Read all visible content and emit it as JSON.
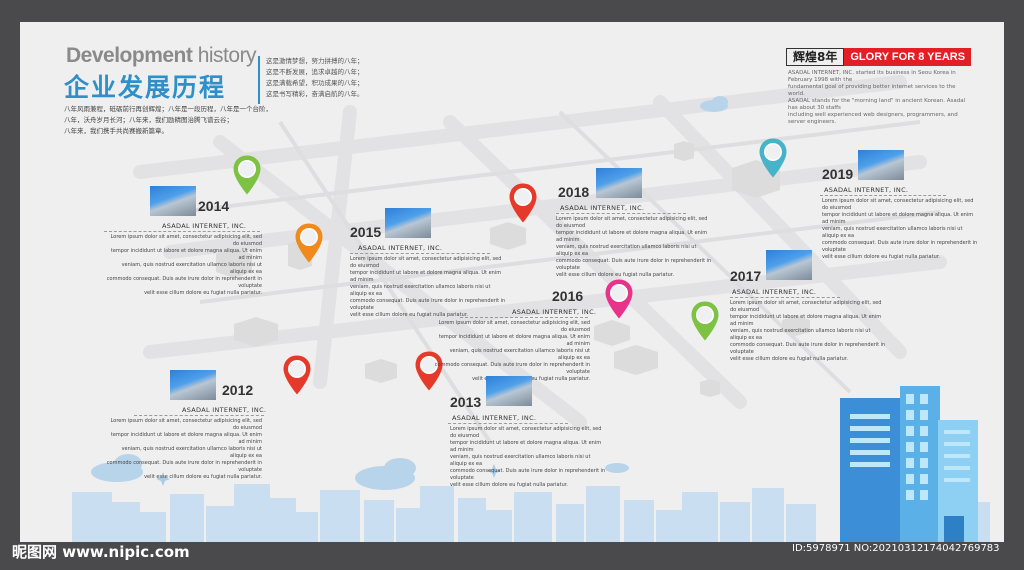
{
  "header": {
    "title_en_bold": "Development",
    "title_en_light": " history",
    "title_cn": "企业发展历程",
    "intro_lines": [
      "八年风雨兼程，砥砺前行再创辉煌；八年是一段历程，八年是一个台阶，",
      "八年，沃舟岁月长河；八年来，我们励精图治腾飞谱云谷；",
      "八年来，我们携手共尚赛搬新篇章。"
    ],
    "poem_lines": [
      "这是激情梦想，努力拼搏的八年；",
      "这是不断发展，追求卓越的八年；",
      "这是满载希望，积功成果的八年；",
      "这是书写精彩，奋满启航的八年。"
    ]
  },
  "badge": {
    "cn": "辉煌8年",
    "en": "GLORY FOR 8 YEARS",
    "text_lines": [
      "ASADAL INTERNET, INC. started its business in Seou Korea in February 1998 with the",
      "fundamental goal of providing better internet services to the world.",
      "ASADAL stands for the \"morning land\" in ancient Korean. Asadal has about 30 staffs",
      "including well experienced web designers, programmers, and server engineers."
    ]
  },
  "milestones": [
    {
      "year": "2014",
      "company": "ASADAL INTERNET, INC."
    },
    {
      "year": "2015",
      "company": "ASADAL INTERNET, INC."
    },
    {
      "year": "2018",
      "company": "ASADAL INTERNET, INC."
    },
    {
      "year": "2019",
      "company": "ASADAL INTERNET, INC."
    },
    {
      "year": "2016",
      "company": "ASADAL INTERNET, INC."
    },
    {
      "year": "2017",
      "company": "ASADAL INTERNET, INC."
    },
    {
      "year": "2012",
      "company": "ASADAL INTERNET, INC."
    },
    {
      "year": "2013",
      "company": "ASADAL INTERNET, INC."
    }
  ],
  "lorem": [
    "Lorem ipsum dolor sit amet, consectetur adipisicing elit, sed do eiusmod",
    "tempor incididunt ut labore et dolore magna aliqua. Ut enim ad minim",
    "veniam, quis nostrud exercitation ullamco laboris nisi ut aliquip ex ea",
    "commodo consequat. Duis aute irure dolor in reprehenderit in voluptate",
    "velit esse cillum dolore eu fugiat nulla pariatur."
  ],
  "pin_colors": {
    "green": "#7dc242",
    "orange": "#f08a1c",
    "red": "#e53a2a",
    "teal": "#46b3c9",
    "pink": "#e7338a"
  },
  "watermark": {
    "left": "昵图网 www.nipic.com",
    "right": "ID:5978971 NO:20210312174042769783"
  }
}
